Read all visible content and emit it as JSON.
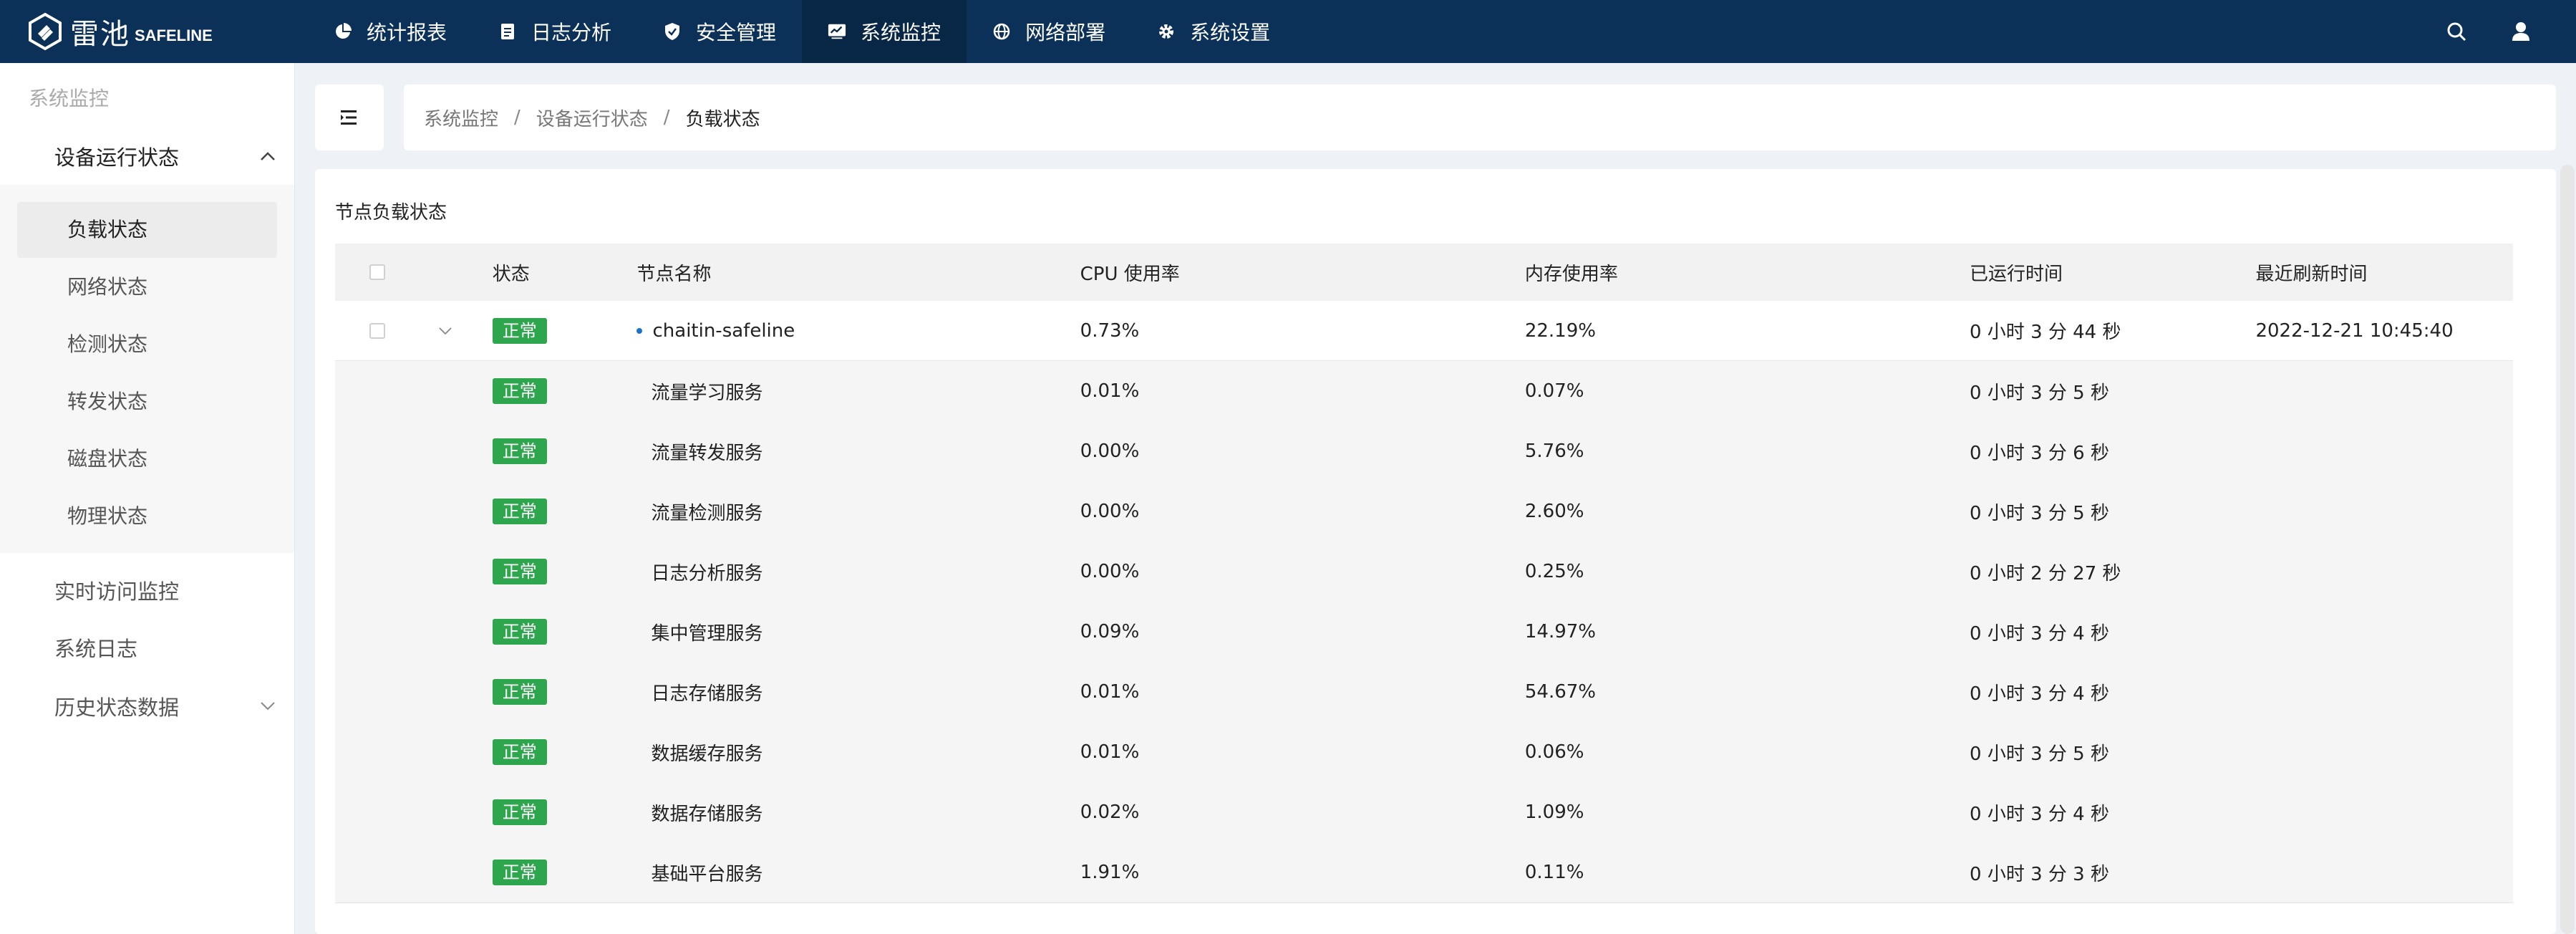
{
  "brand": {
    "cn": "雷池",
    "en": "SAFELINE"
  },
  "nav": [
    {
      "label": "统计报表",
      "icon": "pie-chart-icon",
      "active": false
    },
    {
      "label": "日志分析",
      "icon": "document-icon",
      "active": false
    },
    {
      "label": "安全管理",
      "icon": "shield-check-icon",
      "active": false
    },
    {
      "label": "系统监控",
      "icon": "monitor-chart-icon",
      "active": true
    },
    {
      "label": "网络部署",
      "icon": "globe-icon",
      "active": false
    },
    {
      "label": "系统设置",
      "icon": "gear-icon",
      "active": false
    }
  ],
  "sidebar": {
    "section": "系统监控",
    "group": "设备运行状态",
    "subitems": [
      "负载状态",
      "网络状态",
      "检测状态",
      "转发状态",
      "磁盘状态",
      "物理状态"
    ],
    "items": [
      "实时访问监控",
      "系统日志",
      "历史状态数据"
    ]
  },
  "breadcrumb": [
    "系统监控",
    "设备运行状态",
    "负载状态"
  ],
  "breadcrumb_sep": "/",
  "card_title": "节点负载状态",
  "table": {
    "headers": {
      "status": "状态",
      "name": "节点名称",
      "cpu": "CPU 使用率",
      "mem": "内存使用率",
      "uptime": "已运行时间",
      "refresh": "最近刷新时间"
    },
    "parent": {
      "status": "正常",
      "name": "chaitin-safeline",
      "cpu": "0.73%",
      "mem": "22.19%",
      "uptime": "0 小时 3 分 44 秒",
      "refresh": "2022-12-21 10:45:40"
    },
    "children": [
      {
        "status": "正常",
        "name": "流量学习服务",
        "cpu": "0.01%",
        "mem": "0.07%",
        "uptime": "0 小时 3 分 5 秒"
      },
      {
        "status": "正常",
        "name": "流量转发服务",
        "cpu": "0.00%",
        "mem": "5.76%",
        "uptime": "0 小时 3 分 6 秒"
      },
      {
        "status": "正常",
        "name": "流量检测服务",
        "cpu": "0.00%",
        "mem": "2.60%",
        "uptime": "0 小时 3 分 5 秒"
      },
      {
        "status": "正常",
        "name": "日志分析服务",
        "cpu": "0.00%",
        "mem": "0.25%",
        "uptime": "0 小时 2 分 27 秒"
      },
      {
        "status": "正常",
        "name": "集中管理服务",
        "cpu": "0.09%",
        "mem": "14.97%",
        "uptime": "0 小时 3 分 4 秒"
      },
      {
        "status": "正常",
        "name": "日志存储服务",
        "cpu": "0.01%",
        "mem": "54.67%",
        "uptime": "0 小时 3 分 4 秒"
      },
      {
        "status": "正常",
        "name": "数据缓存服务",
        "cpu": "0.01%",
        "mem": "0.06%",
        "uptime": "0 小时 3 分 5 秒"
      },
      {
        "status": "正常",
        "name": "数据存储服务",
        "cpu": "0.02%",
        "mem": "1.09%",
        "uptime": "0 小时 3 分 4 秒"
      },
      {
        "status": "正常",
        "name": "基础平台服务",
        "cpu": "1.91%",
        "mem": "0.11%",
        "uptime": "0 小时 3 分 3 秒"
      }
    ]
  },
  "colors": {
    "topbar": "#0c3158",
    "active_nav": "#082646",
    "badge": "#2ea64d"
  }
}
